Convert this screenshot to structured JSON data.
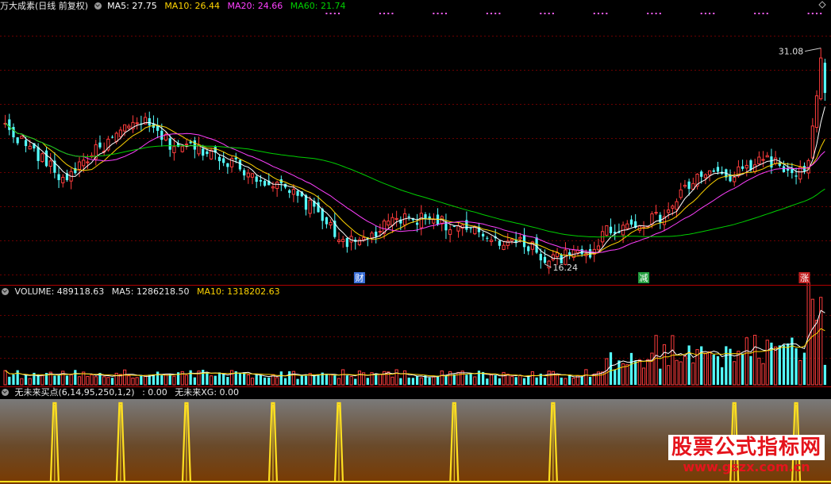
{
  "colors": {
    "up": "#ff3c3c",
    "down": "#54ffff",
    "ma5": "#ffffff",
    "ma10": "#ffd400",
    "ma20": "#ff40ff",
    "ma60": "#00d000",
    "grid": "#6a0000",
    "divider": "#b00000",
    "pulse": "#ffe020",
    "marker_cai": "#3a6fd8",
    "marker_jian": "#24a040",
    "marker_zhang": "#c02020"
  },
  "header_price": {
    "title": "万大成素(日线 前复权)",
    "ma5": "MA5: 27.75",
    "ma10": "MA10: 26.44",
    "ma20": "MA20: 24.66",
    "ma60": "MA60: 21.74"
  },
  "header_volume": {
    "title": "VOLUME: 489118.63",
    "ma5": "MA5: 1286218.50",
    "ma10": "MA10: 1318202.63"
  },
  "header_indicator": {
    "title": "无未来买点(6,14,95,250,1,2)",
    "value": ": 0.00",
    "xg": "无未来XG: 0.00"
  },
  "annotations": {
    "high": "31.08",
    "low": "16.24"
  },
  "markers": [
    "财",
    "减",
    "涨"
  ],
  "watermark": {
    "title": "股票公式指标网",
    "url": "www.gszx.com.cn"
  },
  "chart_data": {
    "type": "candlestick",
    "n_bars": 200,
    "price_range": [
      15.2,
      33.4
    ],
    "ma_periods": [
      5,
      10,
      20,
      60
    ],
    "anchors": {
      "close": [
        [
          0,
          25.7
        ],
        [
          10,
          23.2
        ],
        [
          14,
          22.0
        ],
        [
          20,
          23.6
        ],
        [
          30,
          25.6
        ],
        [
          33,
          26.1
        ],
        [
          40,
          24.5
        ],
        [
          50,
          24.0
        ],
        [
          60,
          22.4
        ],
        [
          70,
          21.0
        ],
        [
          77,
          19.6
        ],
        [
          80,
          18.2
        ],
        [
          85,
          17.6
        ],
        [
          90,
          18.4
        ],
        [
          95,
          19.3
        ],
        [
          105,
          19.4
        ],
        [
          108,
          18.7
        ],
        [
          113,
          18.5
        ],
        [
          120,
          17.9
        ],
        [
          128,
          17.5
        ],
        [
          131,
          16.5
        ],
        [
          138,
          16.9
        ],
        [
          142,
          17.0
        ],
        [
          146,
          18.6
        ],
        [
          150,
          18.8
        ],
        [
          160,
          19.5
        ],
        [
          165,
          21.4
        ],
        [
          170,
          22.6
        ],
        [
          176,
          22.1
        ],
        [
          184,
          23.6
        ],
        [
          188,
          23.0
        ],
        [
          192,
          22.0
        ],
        [
          195,
          23.4
        ],
        [
          197,
          27.6
        ],
        [
          198,
          30.4
        ],
        [
          199,
          28.0
        ]
      ]
    },
    "volume_range": [
      0,
      5000000
    ],
    "volume_base": 620000,
    "indicator_pulses_at_bar": [
      12,
      28,
      44,
      65,
      81,
      109,
      133,
      177,
      192
    ]
  }
}
